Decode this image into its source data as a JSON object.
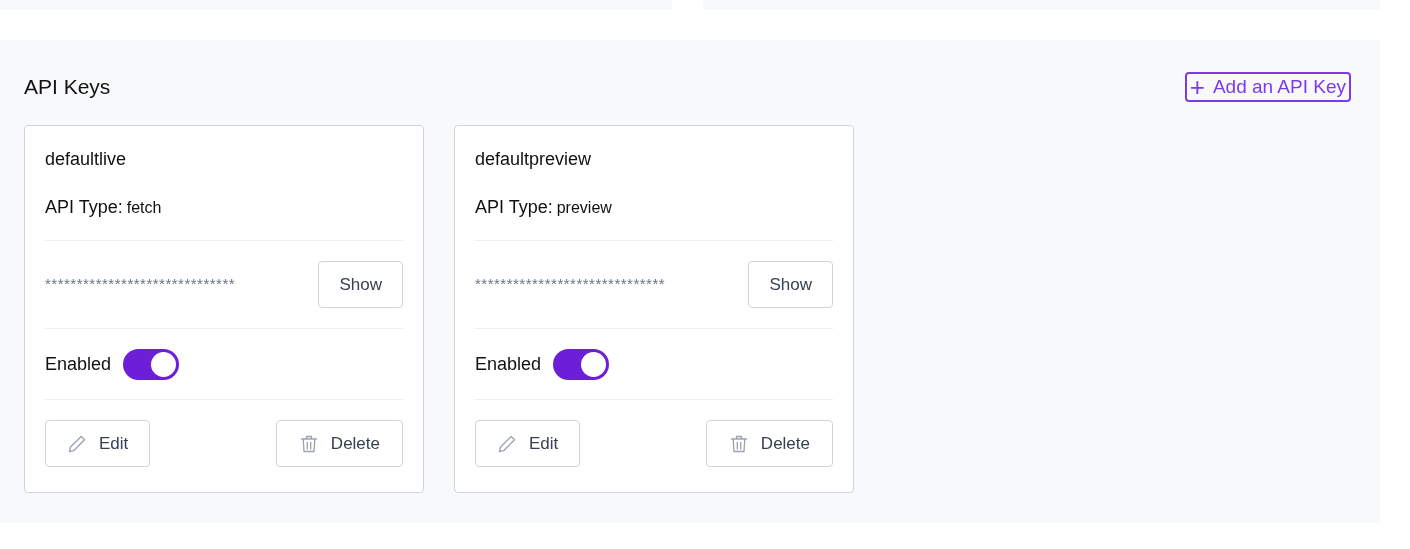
{
  "section": {
    "title": "API Keys",
    "add_button": {
      "icon": "+",
      "label": "Add an API Key"
    }
  },
  "keys": [
    {
      "name": "defaultlive",
      "type_label": "API Type:",
      "type": "fetch",
      "masked_key": "******************************",
      "show_button": "Show",
      "enabled_label": "Enabled",
      "enabled": true,
      "edit_button": "Edit",
      "delete_button": "Delete"
    },
    {
      "name": "defaultpreview",
      "type_label": "API Type:",
      "type": "preview",
      "masked_key": "******************************",
      "show_button": "Show",
      "enabled_label": "Enabled",
      "enabled": true,
      "edit_button": "Edit",
      "delete_button": "Delete"
    }
  ]
}
